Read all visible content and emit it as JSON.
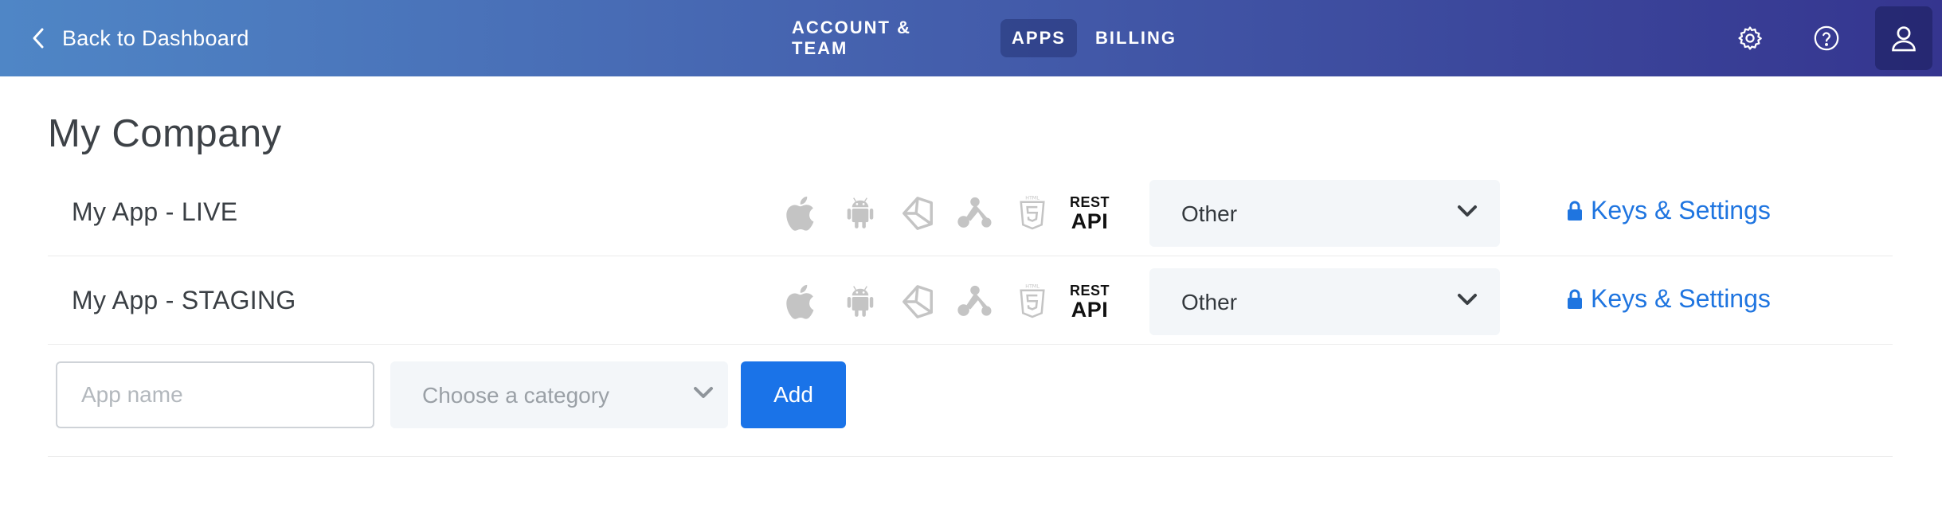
{
  "header": {
    "back_label": "Back to Dashboard",
    "tabs": [
      {
        "label": "ACCOUNT & TEAM",
        "active": false
      },
      {
        "label": "APPS",
        "active": true
      },
      {
        "label": "BILLING",
        "active": false
      }
    ],
    "icons": [
      "gear-icon",
      "help-icon",
      "user-icon"
    ]
  },
  "company": {
    "name": "My Company"
  },
  "apps": [
    {
      "name": "My App - LIVE",
      "platforms": [
        "apple-icon",
        "android-icon",
        "unity-icon",
        "adobe-air-icon",
        "html5-icon",
        "rest-api-icon"
      ],
      "rest_line1": "REST",
      "rest_line2": "API",
      "category": "Other",
      "keys_label": "Keys & Settings"
    },
    {
      "name": "My App - STAGING",
      "platforms": [
        "apple-icon",
        "android-icon",
        "unity-icon",
        "adobe-air-icon",
        "html5-icon",
        "rest-api-icon"
      ],
      "rest_line1": "REST",
      "rest_line2": "API",
      "category": "Other",
      "keys_label": "Keys & Settings"
    }
  ],
  "new_app": {
    "name_placeholder": "App name",
    "category_placeholder": "Choose a category",
    "add_label": "Add"
  },
  "colors": {
    "header_gradient_start": "#4f86c6",
    "header_gradient_end": "#35358f",
    "link_blue": "#1f75e0",
    "button_blue": "#1a73e8",
    "platform_icon_gray": "#c4c4c4"
  }
}
